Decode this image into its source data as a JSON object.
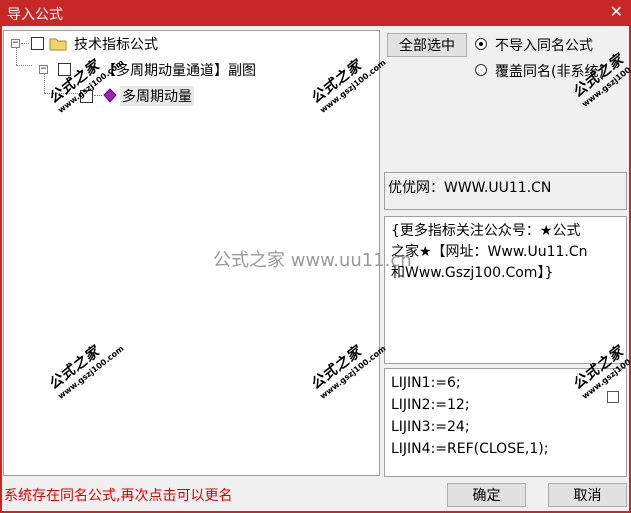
{
  "window": {
    "title": "导入公式",
    "close_glyph": "✕"
  },
  "tree": {
    "root": {
      "expander": "−",
      "label": "技术指标公式"
    },
    "child": {
      "expander": "−",
      "label": "【多周期动量通道】副图"
    },
    "leaf": {
      "label": "多周期动量"
    }
  },
  "options": {
    "select_all_label": "全部选中",
    "radio_skip_label": "不导入同名公式",
    "radio_overwrite_label": "覆盖同名(非系统)",
    "selected": "skip"
  },
  "website_field": "优优网：WWW.UU11.CN",
  "description_lines": [
    "{更多指标关注公众号：★公式",
    "之家★【网址：Www.Uu11.Cn",
    "和Www.Gszj100.Com】}"
  ],
  "code_lines": [
    "LIJIN1:=6;",
    "LIJIN2:=12;",
    "LIJIN3:=24;",
    "LIJIN4:=REF(CLOSE,1);"
  ],
  "status_text": "系统存在同名公式,再次点击可以更名",
  "buttons": {
    "ok": "确定",
    "cancel": "取消"
  },
  "watermark": {
    "brand": "公式之家",
    "url": "www.gszj100.com",
    "center": "公式之家 www.uu11.cn"
  },
  "colors": {
    "titlebar": "#c62828",
    "status_text": "#e00000"
  }
}
